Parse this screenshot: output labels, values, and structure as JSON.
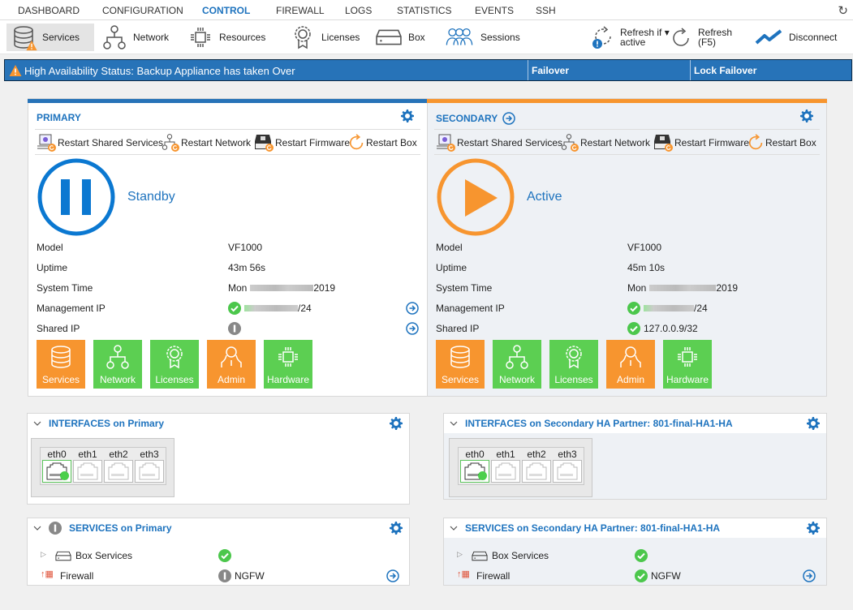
{
  "nav": {
    "tabs": [
      {
        "label": "DASHBOARD",
        "active": false
      },
      {
        "label": "CONFIGURATION",
        "active": false
      },
      {
        "label": "CONTROL",
        "active": true
      },
      {
        "label": "FIREWALL",
        "active": false
      },
      {
        "label": "LOGS",
        "active": false
      },
      {
        "label": "STATISTICS",
        "active": false
      },
      {
        "label": "EVENTS",
        "active": false
      },
      {
        "label": "SSH",
        "active": false
      }
    ],
    "refresh_icon": "refresh-icon"
  },
  "toolbar": {
    "items": [
      {
        "label": "Services",
        "icon": "database-warning-icon",
        "selected": true
      },
      {
        "label": "Network",
        "icon": "network-icon"
      },
      {
        "label": "Resources",
        "icon": "chip-icon"
      },
      {
        "label": "Licenses",
        "icon": "license-badge-icon"
      },
      {
        "label": "Box",
        "icon": "box-icon"
      },
      {
        "label": "Sessions",
        "icon": "users-icon"
      }
    ],
    "refresh_if_active": {
      "line1": "Refresh if",
      "line2": "active"
    },
    "refresh": {
      "line1": "Refresh",
      "line2": "(F5)"
    },
    "disconnect": "Disconnect"
  },
  "status": {
    "text": "High Availability Status: Backup Appliance has taken Over",
    "failover": "Failover",
    "lock_failover": "Lock Failover",
    "color": "#2773b8"
  },
  "restart_actions": [
    "Restart Shared Services",
    "Restart Network",
    "Restart Firmware",
    "Restart Box"
  ],
  "info_labels": {
    "model": "Model",
    "uptime": "Uptime",
    "system_time": "System Time",
    "management_ip": "Management IP",
    "shared_ip": "Shared IP"
  },
  "tiles": [
    {
      "label": "Services",
      "status": "warning"
    },
    {
      "label": "Network",
      "status": "ok"
    },
    {
      "label": "Licenses",
      "status": "ok"
    },
    {
      "label": "Admin",
      "status": "warning"
    },
    {
      "label": "Hardware",
      "status": "ok"
    }
  ],
  "colors": {
    "ok": "#5ccf52",
    "warning": "#f7952f",
    "accent": "#1e73be",
    "primary_bar": "#2773b8",
    "secondary_bar": "#f7952f"
  },
  "primary": {
    "title": "PRIMARY",
    "state": "Standby",
    "model": "VF1000",
    "uptime": "43m 56s",
    "system_time_prefix": "Mon",
    "system_time_suffix": "2019",
    "management_ip_suffix": "/24",
    "shared_ip": ""
  },
  "secondary": {
    "title": "SECONDARY",
    "state": "Active",
    "model": "VF1000",
    "uptime": "45m 10s",
    "system_time_prefix": "Mon",
    "system_time_suffix": "2019",
    "management_ip_suffix": "/24",
    "shared_ip": "127.0.0.9/32"
  },
  "interfaces_primary": {
    "title": "INTERFACES on Primary",
    "ports": [
      {
        "name": "eth0",
        "up": true
      },
      {
        "name": "eth1",
        "up": false
      },
      {
        "name": "eth2",
        "up": false
      },
      {
        "name": "eth3",
        "up": false
      }
    ]
  },
  "interfaces_secondary": {
    "title": "INTERFACES on Secondary HA Partner: 801-final-HA1-HA",
    "ports": [
      {
        "name": "eth0",
        "up": true
      },
      {
        "name": "eth1",
        "up": false
      },
      {
        "name": "eth2",
        "up": false
      },
      {
        "name": "eth3",
        "up": false
      }
    ]
  },
  "services_primary": {
    "title": "SERVICES on Primary",
    "rows": [
      {
        "name": "Box Services",
        "status": "ok",
        "value": ""
      },
      {
        "name": "Firewall",
        "status": "info",
        "value": "NGFW"
      }
    ]
  },
  "services_secondary": {
    "title": "SERVICES on Secondary HA Partner: 801-final-HA1-HA",
    "rows": [
      {
        "name": "Box Services",
        "status": "ok",
        "value": ""
      },
      {
        "name": "Firewall",
        "status": "ok",
        "value": "NGFW"
      }
    ]
  }
}
